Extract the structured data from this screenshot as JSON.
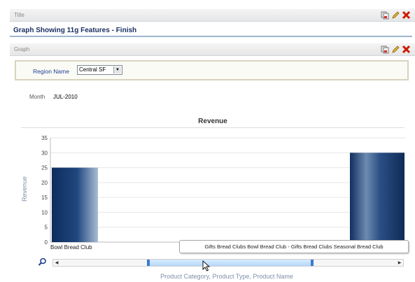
{
  "title_panel": {
    "caption": "Title",
    "heading": "Graph Showing 11g Features - Finish"
  },
  "graph_panel": {
    "caption": "Graph"
  },
  "region": {
    "label": "Region Name",
    "selected": "Central SF"
  },
  "month": {
    "label": "Month",
    "value": "JUL-2010"
  },
  "tooltip_text": "Gifts Bread Clubs Bowl Bread Club - Gifts Bread Clubs Seasonal Bread Club",
  "colors": {
    "bar_dark": "#0d2c5e",
    "bar_light": "#a9bdd3",
    "accent": "#1a2f63",
    "delete": "#cc1a00",
    "edit": "#d4a017"
  },
  "icons": [
    "copy-icon",
    "edit-pencil-icon",
    "delete-x-icon",
    "zoom-magnifier-icon",
    "mouse-pointer-icon"
  ],
  "chart_data": {
    "type": "bar",
    "title": "Revenue",
    "ylabel": "Revenue",
    "xlabel": "Product Category, Product Type, Product Name",
    "ylim": [
      0,
      35
    ],
    "yticks": [
      0,
      5,
      10,
      15,
      20,
      25,
      30,
      35
    ],
    "grid": true,
    "categories": [
      "Bowl Bread Club",
      "Seasonal Bread Club"
    ],
    "values": [
      25,
      30
    ],
    "visible_labels": [
      "Bowl Bread Club",
      ""
    ]
  }
}
